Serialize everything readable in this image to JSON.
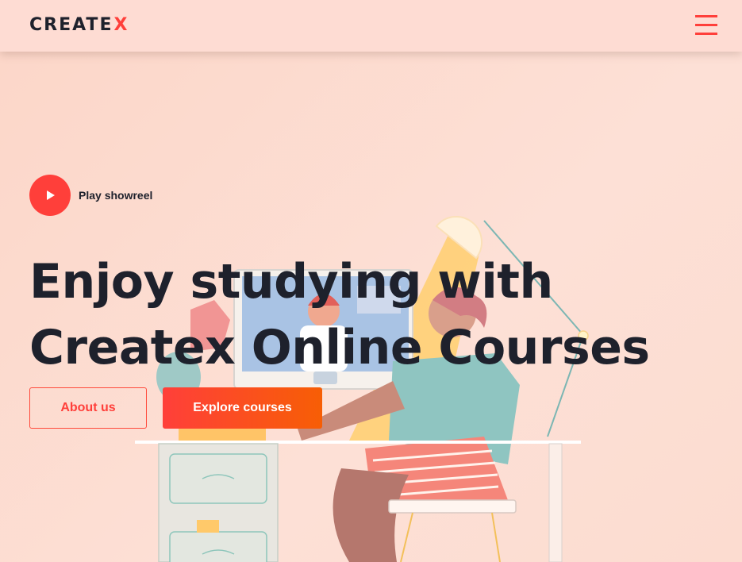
{
  "header": {
    "logo_text": "CREATE",
    "logo_accent": "X",
    "menu_icon": "hamburger-menu-icon"
  },
  "hero": {
    "play_label": "Play showreel",
    "title_line1": "Enjoy studying with",
    "title_line2": "Createx Online Courses",
    "about_button": "About us",
    "explore_button": "Explore courses"
  },
  "colors": {
    "accent": "#ff3f3a",
    "accent_gradient_end": "#f75e05",
    "text_dark": "#1e212c",
    "background": "#fddcd2"
  }
}
